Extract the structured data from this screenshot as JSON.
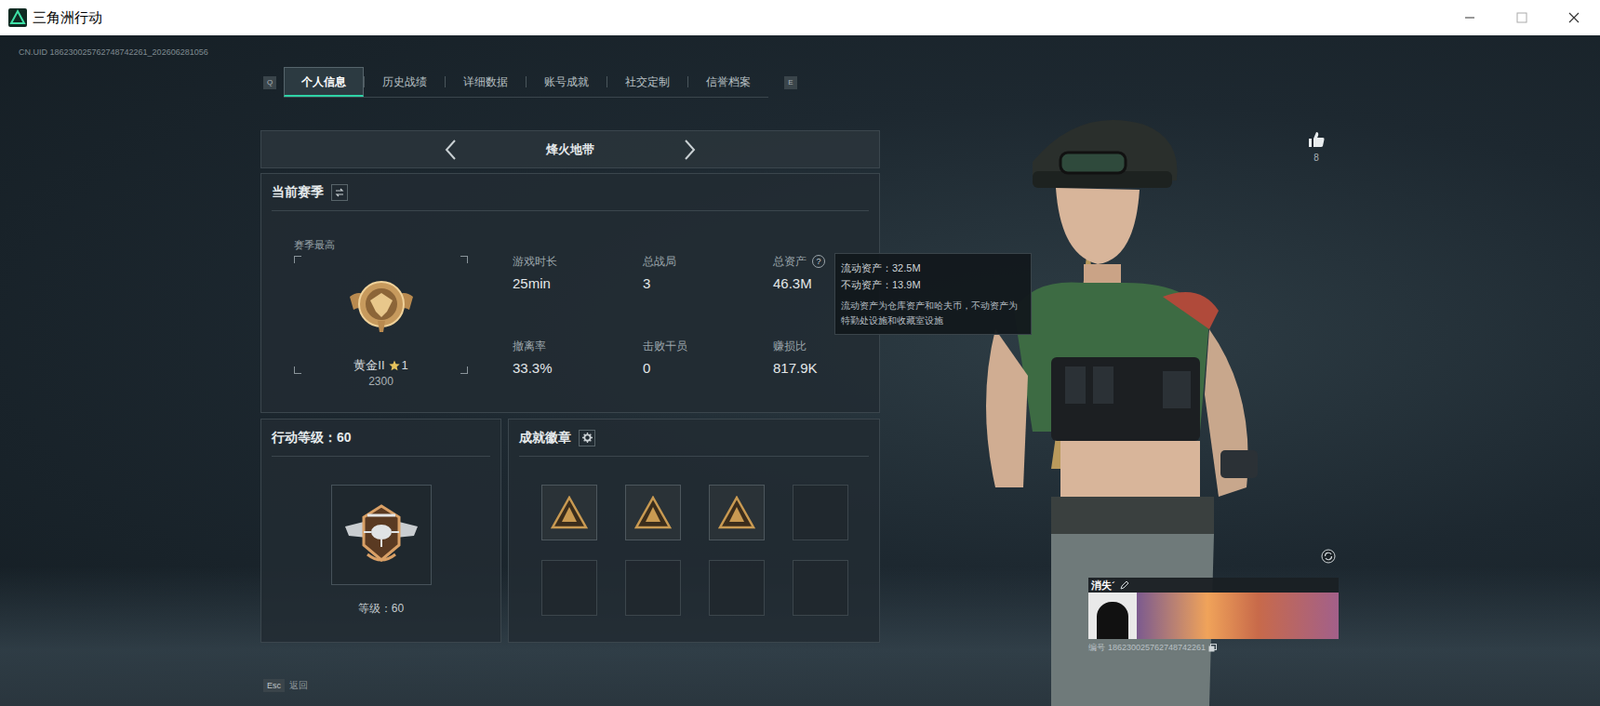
{
  "window": {
    "title": "三角洲行动"
  },
  "uid": "CN.UID 186230025762748742261_202606281056",
  "tab_keys": {
    "prev": "Q",
    "next": "E"
  },
  "tabs": [
    {
      "label": "个人信息",
      "selected": true
    },
    {
      "label": "历史战绩",
      "selected": false
    },
    {
      "label": "详细数据",
      "selected": false
    },
    {
      "label": "账号成就",
      "selected": false
    },
    {
      "label": "社交定制",
      "selected": false
    },
    {
      "label": "信誉档案",
      "selected": false
    }
  ],
  "mode": {
    "label": "烽火地带"
  },
  "season": {
    "title": "当前赛季",
    "best_label": "赛季最高",
    "rank": "黄金II",
    "star_level": "1",
    "score": "2300",
    "stats": [
      {
        "label": "游戏时长",
        "value": "25min",
        "help": ""
      },
      {
        "label": "总战局",
        "value": "3",
        "help": ""
      },
      {
        "label": "总资产",
        "value": "46.3M",
        "help": "?"
      },
      {
        "label": "撤离率",
        "value": "33.3%",
        "help": ""
      },
      {
        "label": "击败干员",
        "value": "0",
        "help": ""
      },
      {
        "label": "赚损比",
        "value": "817.9K",
        "help": ""
      }
    ]
  },
  "tooltip": {
    "lines": [
      "流动资产：32.5M",
      "不动资产：13.9M"
    ],
    "note": "流动资产为仓库资产和哈夫币，不动资产为特勤处设施和收藏室设施"
  },
  "level": {
    "title": "行动等级：60",
    "caption": "等级：60"
  },
  "badges": {
    "title": "成就徽章",
    "slots": [
      {
        "filled": true
      },
      {
        "filled": true
      },
      {
        "filled": true
      },
      {
        "filled": false
      },
      {
        "filled": false
      },
      {
        "filled": false
      },
      {
        "filled": false
      },
      {
        "filled": false
      }
    ]
  },
  "likes": {
    "count": "8"
  },
  "profile": {
    "name": "消失´",
    "id_label": "编号",
    "id": "186230025762748742261"
  },
  "footer": {
    "key": "Esc",
    "label": "返回"
  }
}
